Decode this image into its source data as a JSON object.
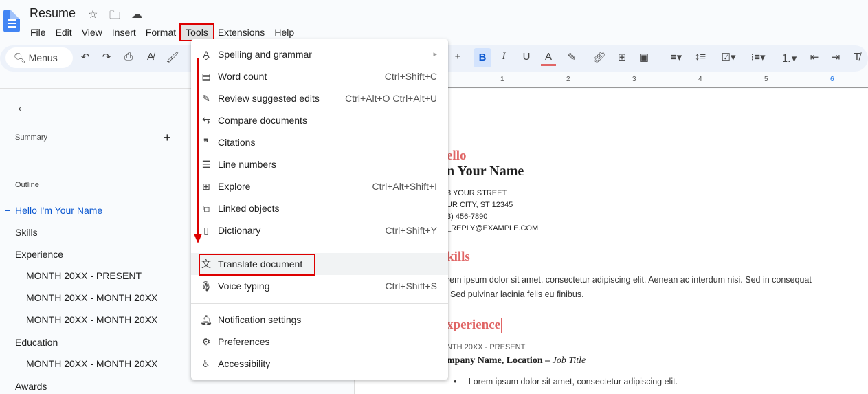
{
  "app": {
    "title": "Resume",
    "icons": [
      "star-icon",
      "move-to-folder-icon",
      "cloud-saved-icon"
    ]
  },
  "menubar": [
    "File",
    "Edit",
    "View",
    "Insert",
    "Format",
    "Tools",
    "Extensions",
    "Help"
  ],
  "toolbar": {
    "search_label": "Menus",
    "bold": "B",
    "italic": "I",
    "underline": "U",
    "text_color": "A",
    "text_color_hex": "#e06666"
  },
  "ruler": [
    "1",
    "2",
    "3",
    "4",
    "5",
    "6"
  ],
  "sidebar": {
    "summary": "Summary",
    "outline": "Outline",
    "items": [
      {
        "label": "Hello I'm Your Name",
        "level": 1,
        "active": true
      },
      {
        "label": "Skills",
        "level": 1
      },
      {
        "label": "Experience",
        "level": 1
      },
      {
        "label": "MONTH 20XX - PRESENT",
        "level": 2
      },
      {
        "label": "MONTH 20XX - MONTH 20XX",
        "level": 2
      },
      {
        "label": "MONTH 20XX - MONTH 20XX",
        "level": 2
      },
      {
        "label": "Education",
        "level": 1
      },
      {
        "label": "MONTH 20XX - MONTH 20XX",
        "level": 2
      },
      {
        "label": "Awards",
        "level": 1
      }
    ]
  },
  "document": {
    "hello": "ello",
    "name": "n Your Name",
    "street": "3 YOUR STREET",
    "city": "UR CITY, ST 12345",
    "phone": "3) 456-7890",
    "email": "_REPLY@EXAMPLE.COM",
    "skills": "kills",
    "skills_text1": "rem ipsum dolor sit amet, consectetur adipiscing elit. Aenean ac interdum nisi. Sed in consequat",
    "skills_text2": "Sed pulvinar lacinia felis eu finibus.",
    "experience": "xperience",
    "date": "NTH 20XX - PRESENT",
    "company": "mpany Name, Location – ",
    "job": "Job Title",
    "bullet": "Lorem ipsum dolor sit amet, consectetur adipiscing elit.",
    "accent": "#e06666"
  },
  "tools_menu": {
    "items": [
      {
        "label": "Spelling and grammar",
        "shortcut": "▸",
        "icon": "spelling-icon"
      },
      {
        "label": "Word count",
        "shortcut": "Ctrl+Shift+C",
        "icon": "word-count-icon"
      },
      {
        "label": "Review suggested edits",
        "shortcut": "Ctrl+Alt+O Ctrl+Alt+U",
        "icon": "review-edits-icon"
      },
      {
        "label": "Compare documents",
        "shortcut": "",
        "icon": "compare-icon"
      },
      {
        "label": "Citations",
        "shortcut": "",
        "icon": "quote-icon"
      },
      {
        "label": "Line numbers",
        "shortcut": "",
        "icon": "line-numbers-icon"
      },
      {
        "label": "Explore",
        "shortcut": "Ctrl+Alt+Shift+I",
        "icon": "explore-icon"
      },
      {
        "label": "Linked objects",
        "shortcut": "",
        "icon": "link-objects-icon"
      },
      {
        "label": "Dictionary",
        "shortcut": "Ctrl+Shift+Y",
        "icon": "dictionary-icon"
      },
      {
        "label": "Translate document",
        "shortcut": "",
        "icon": "translate-icon",
        "highlighted": true
      },
      {
        "label": "Voice typing",
        "shortcut": "Ctrl+Shift+S",
        "icon": "mic-icon"
      },
      {
        "label": "Notification settings",
        "shortcut": "",
        "icon": "bell-icon"
      },
      {
        "label": "Preferences",
        "shortcut": "",
        "icon": "preferences-icon"
      },
      {
        "label": "Accessibility",
        "shortcut": "",
        "icon": "accessibility-icon"
      }
    ]
  },
  "annotation_color": "#dd0000"
}
